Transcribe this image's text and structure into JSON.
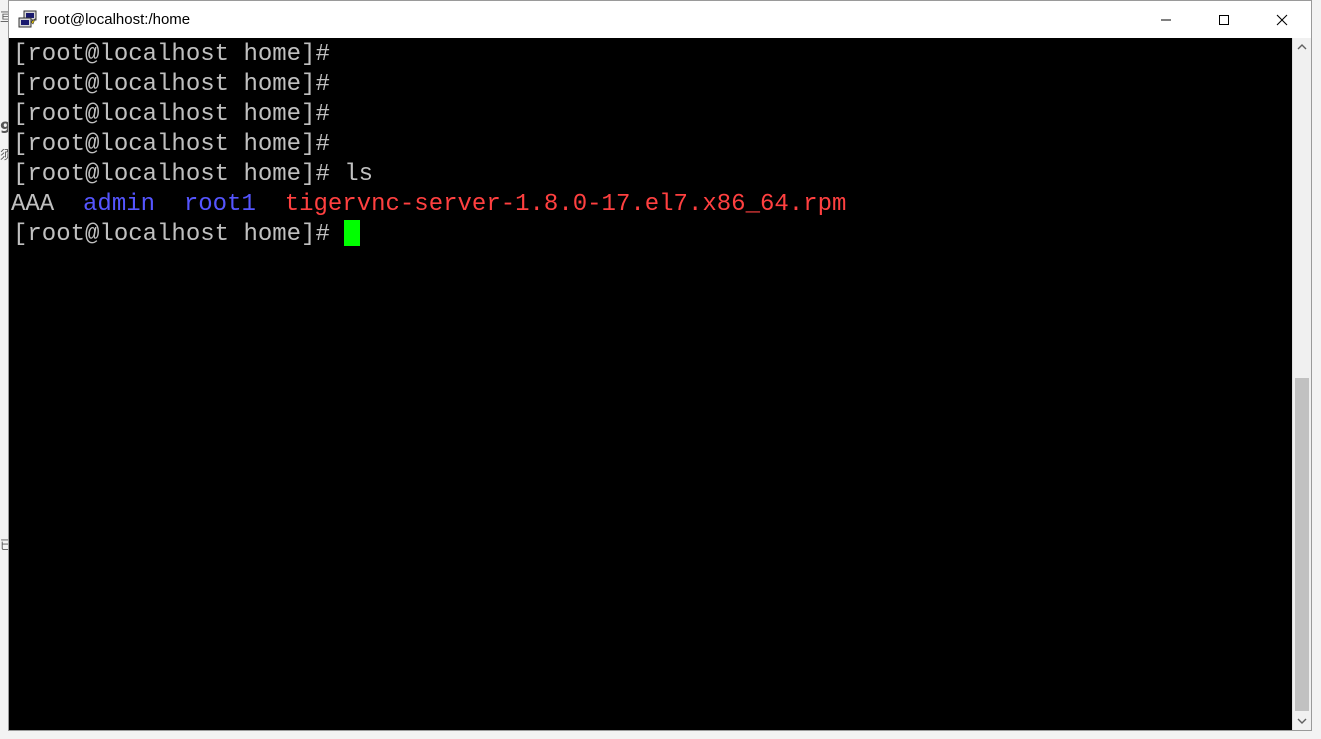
{
  "window": {
    "title": "root@localhost:/home"
  },
  "terminal": {
    "prompt_lines": [
      "[root@localhost home]#",
      "[root@localhost home]#",
      "[root@localhost home]#",
      "[root@localhost home]#"
    ],
    "command_line": {
      "prompt": "[root@localhost home]#",
      "command": "ls"
    },
    "ls_output": [
      {
        "name": "AAA",
        "type": "file"
      },
      {
        "name": "admin",
        "type": "directory"
      },
      {
        "name": "root1",
        "type": "directory"
      },
      {
        "name": "tigervnc-server-1.8.0-17.el7.x86_64.rpm",
        "type": "archive"
      }
    ],
    "current_prompt": "[root@localhost home]#"
  },
  "colors": {
    "terminal_bg": "#000000",
    "text_default": "#c0c0c0",
    "directory": "#5555ff",
    "archive": "#ff4040",
    "cursor": "#00ff00"
  },
  "icons": {
    "app": "putty-icon",
    "minimize": "minimize-icon",
    "maximize": "maximize-icon",
    "close": "close-icon"
  }
}
